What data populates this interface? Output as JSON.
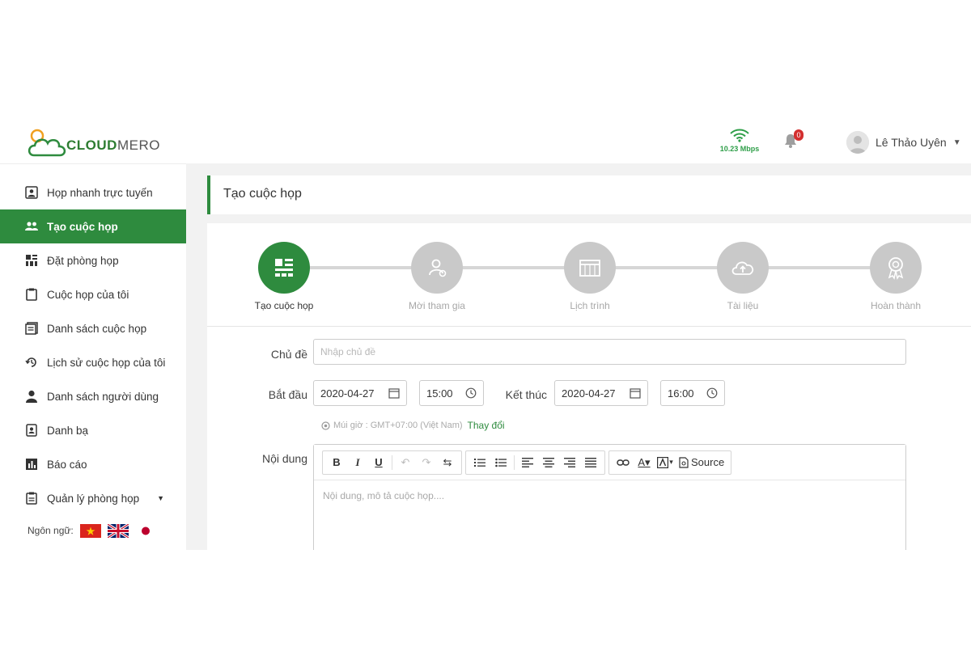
{
  "header": {
    "logo_text": "CLOUDMERO",
    "net_speed": "10.23 Mbps",
    "notification_count": "0",
    "user_name": "Lê Thảo Uyên"
  },
  "sidebar": {
    "items": [
      {
        "label": "Họp nhanh trực tuyến",
        "icon": "monitor-user-icon"
      },
      {
        "label": "Tạo cuộc họp",
        "icon": "users-icon",
        "active": true
      },
      {
        "label": "Đặt phòng họp",
        "icon": "room-grid-icon"
      },
      {
        "label": "Cuộc họp của tôi",
        "icon": "clipboard-icon"
      },
      {
        "label": "Danh sách cuộc họp",
        "icon": "list-doc-icon"
      },
      {
        "label": "Lịch sử cuộc họp của tôi",
        "icon": "history-icon"
      },
      {
        "label": "Danh sách người dùng",
        "icon": "user-icon"
      },
      {
        "label": "Danh bạ",
        "icon": "contact-book-icon"
      },
      {
        "label": "Báo cáo",
        "icon": "bar-chart-icon"
      },
      {
        "label": "Quản lý phòng họp",
        "icon": "clipboard-manage-icon"
      }
    ],
    "language_label": "Ngôn ngữ:"
  },
  "page": {
    "title": "Tạo cuộc họp"
  },
  "stepper": {
    "steps": [
      {
        "label": "Tạo cuộc họp",
        "icon": "form-icon",
        "active": true
      },
      {
        "label": "Mời tham gia",
        "icon": "invite-user-icon"
      },
      {
        "label": "Lịch trình",
        "icon": "calendar-icon"
      },
      {
        "label": "Tài liệu",
        "icon": "cloud-upload-icon"
      },
      {
        "label": "Hoàn thành",
        "icon": "badge-complete-icon"
      }
    ]
  },
  "form": {
    "subject_label": "Chủ đề",
    "subject_placeholder": "Nhập chủ đề",
    "start_label": "Bắt đầu",
    "start_date": "2020-04-27",
    "start_time": "15:00",
    "end_label": "Kết thúc",
    "end_date": "2020-04-27",
    "end_time": "16:00",
    "timezone_text": "Múi giờ : GMT+07:00 (Việt Nam)",
    "timezone_change": "Thay đổi",
    "content_label": "Nội dung",
    "content_placeholder": "Nội dung, mô tả cuộc họp...."
  },
  "editor": {
    "bold": "B",
    "italic": "I",
    "underline": "U",
    "source": "Source"
  },
  "colors": {
    "accent": "#2e8b3e",
    "step_inactive": "#c9c9c9",
    "badge": "#d32f2f"
  }
}
